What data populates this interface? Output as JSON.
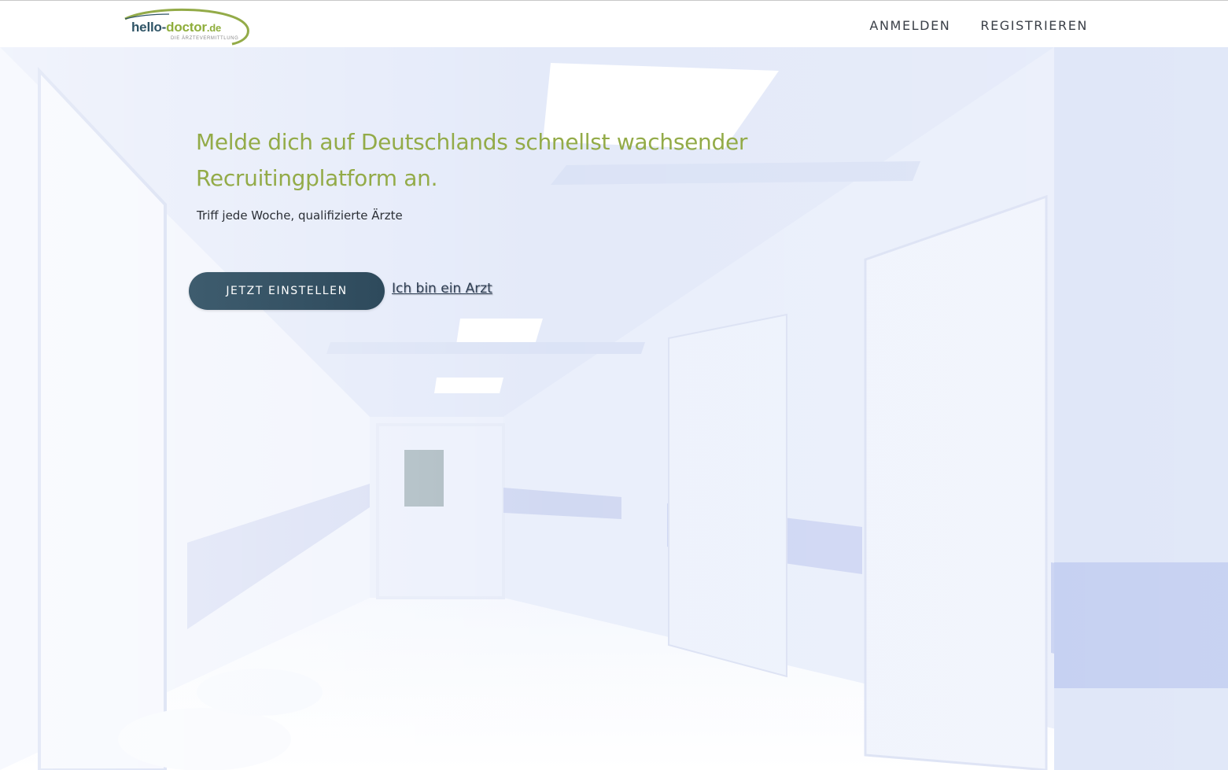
{
  "header": {
    "logo": {
      "part1": "hello-",
      "part2": "doctor",
      "part3": ".de",
      "tagline": "DIE ÄRZTEVERMITTLUNG"
    },
    "nav": {
      "login": "ANMELDEN",
      "register": "REGISTRIEREN"
    }
  },
  "hero": {
    "headline": "Melde dich auf Deutschlands schnellst wachsender Recruitingplatform an.",
    "subline": "Triff jede Woche, qualifizierte Ärzte",
    "cta_label": "JETZT EINSTELLEN",
    "doctor_link": "Ich bin ein Arzt"
  },
  "colors": {
    "brand_green": "#93ab48",
    "brand_dark": "#2f5466",
    "button_bg": "#36566a"
  }
}
